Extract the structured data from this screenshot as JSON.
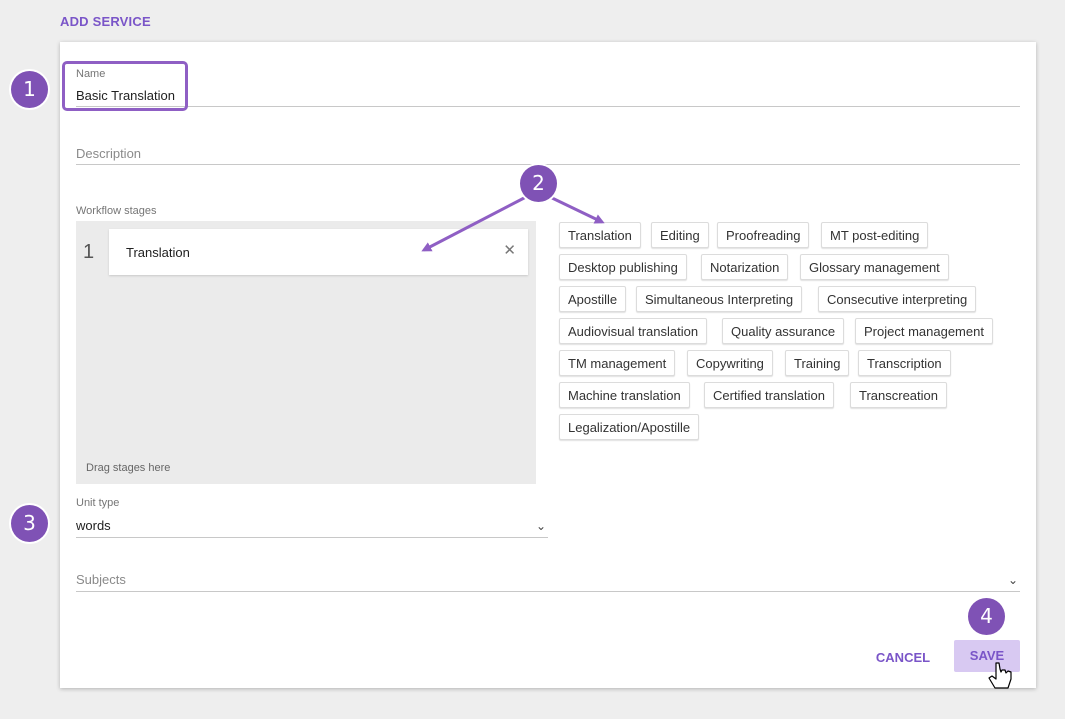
{
  "page": {
    "title": "ADD SERVICE"
  },
  "form": {
    "name": {
      "label": "Name",
      "value": "Basic Translation"
    },
    "description": {
      "placeholder": "Description"
    },
    "workflow": {
      "label": "Workflow stages",
      "stages": [
        {
          "number": "1",
          "label": "Translation"
        }
      ],
      "remove_icon": "close-icon",
      "drag_hint": "Drag stages here"
    },
    "stage_options": [
      "Translation",
      "Editing",
      "Proofreading",
      "MT post-editing",
      "Desktop publishing",
      "Notarization",
      "Glossary management",
      "Apostille",
      "Simultaneous Interpreting",
      "Consecutive interpreting",
      "Audiovisual translation",
      "Quality assurance",
      "Project management",
      "TM management",
      "Copywriting",
      "Training",
      "Transcription",
      "Machine translation",
      "Certified translation",
      "Transcreation",
      "Legalization/Apostille"
    ],
    "unit_type": {
      "label": "Unit type",
      "value": "words"
    },
    "subjects": {
      "placeholder": "Subjects"
    }
  },
  "actions": {
    "cancel_label": "CANCEL",
    "save_label": "SAVE"
  },
  "annotations": {
    "badges": [
      "1",
      "2",
      "3",
      "4"
    ],
    "color": "#7f52b5"
  },
  "colors": {
    "accent": "#7a55c8",
    "save_bg": "#d8c9f2"
  }
}
